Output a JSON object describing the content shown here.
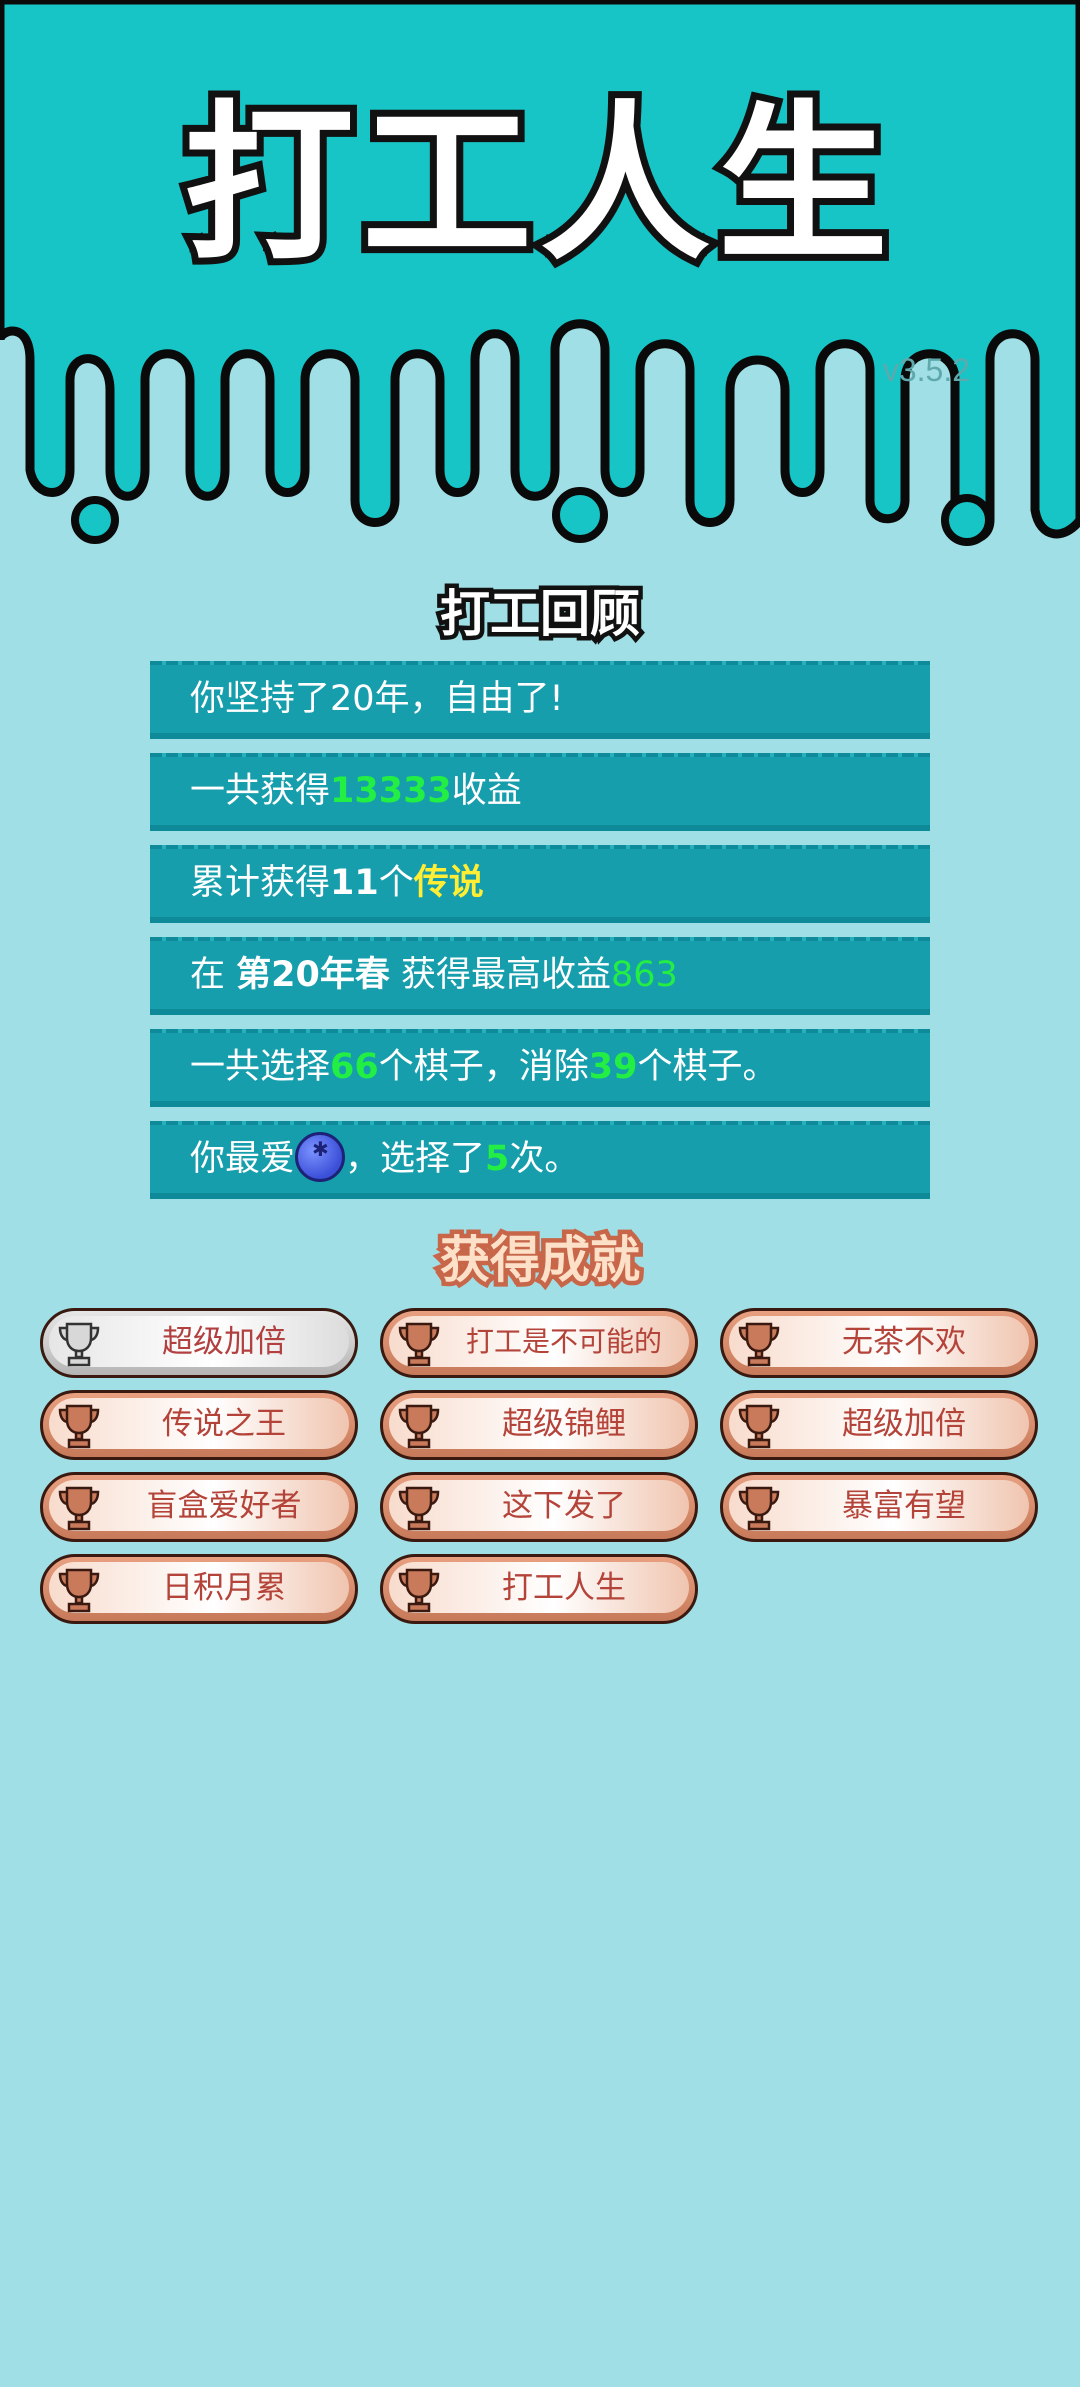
{
  "app": {
    "title": "打工人生",
    "version": "v3.5.2"
  },
  "review": {
    "title": "打工回顾",
    "line1": "你坚持了20年，自由了!",
    "line2": {
      "pre": "一共获得",
      "value": "13333",
      "post": "收益"
    },
    "line3": {
      "pre": "累计获得",
      "count": "11",
      "mid": "个",
      "tag": "传说"
    },
    "line4": {
      "pre": "在 ",
      "season": "第20年春",
      "mid": " 获得最高收益",
      "value": "863"
    },
    "line5": {
      "pre": "一共选择",
      "chosen": "66",
      "mid": "个棋子，消除",
      "removed": "39",
      "post": "个棋子。"
    },
    "line6": {
      "pre": "你最爱",
      "icon": "blueberry-icon",
      "mid": "，选择了",
      "times": "5",
      "post": "次。"
    }
  },
  "achievements": {
    "title": "获得成就",
    "items": [
      {
        "label": "超级加倍",
        "tier": "silver"
      },
      {
        "label": "打工是不可能的",
        "tier": "bronze"
      },
      {
        "label": "无茶不欢",
        "tier": "bronze"
      },
      {
        "label": "传说之王",
        "tier": "bronze"
      },
      {
        "label": "超级锦鲤",
        "tier": "bronze"
      },
      {
        "label": "超级加倍",
        "tier": "bronze"
      },
      {
        "label": "盲盒爱好者",
        "tier": "bronze"
      },
      {
        "label": "这下发了",
        "tier": "bronze"
      },
      {
        "label": "暴富有望",
        "tier": "bronze"
      },
      {
        "label": "日积月累",
        "tier": "bronze"
      },
      {
        "label": "打工人生",
        "tier": "bronze"
      }
    ]
  },
  "colors": {
    "header": "#17c4c6",
    "background": "#a0dfe5",
    "row": "#179eac",
    "highlight_green": "#22ee44",
    "highlight_yellow": "#ffee33"
  }
}
